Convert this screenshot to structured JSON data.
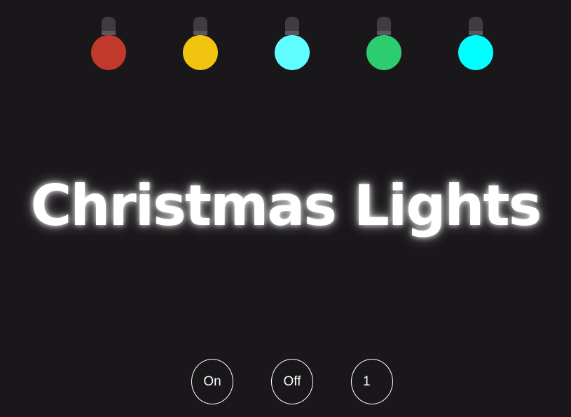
{
  "bulbs": [
    {
      "name": "red",
      "color": "#c0392b"
    },
    {
      "name": "yellow",
      "color": "#f1c40f"
    },
    {
      "name": "light-cyan",
      "color": "#5ffdff"
    },
    {
      "name": "green",
      "color": "#2ecc71"
    },
    {
      "name": "cyan",
      "color": "#00ffff"
    }
  ],
  "title": "Christmas Lights",
  "controls": {
    "on_label": "On",
    "off_label": "Off",
    "speed_value": "1"
  }
}
